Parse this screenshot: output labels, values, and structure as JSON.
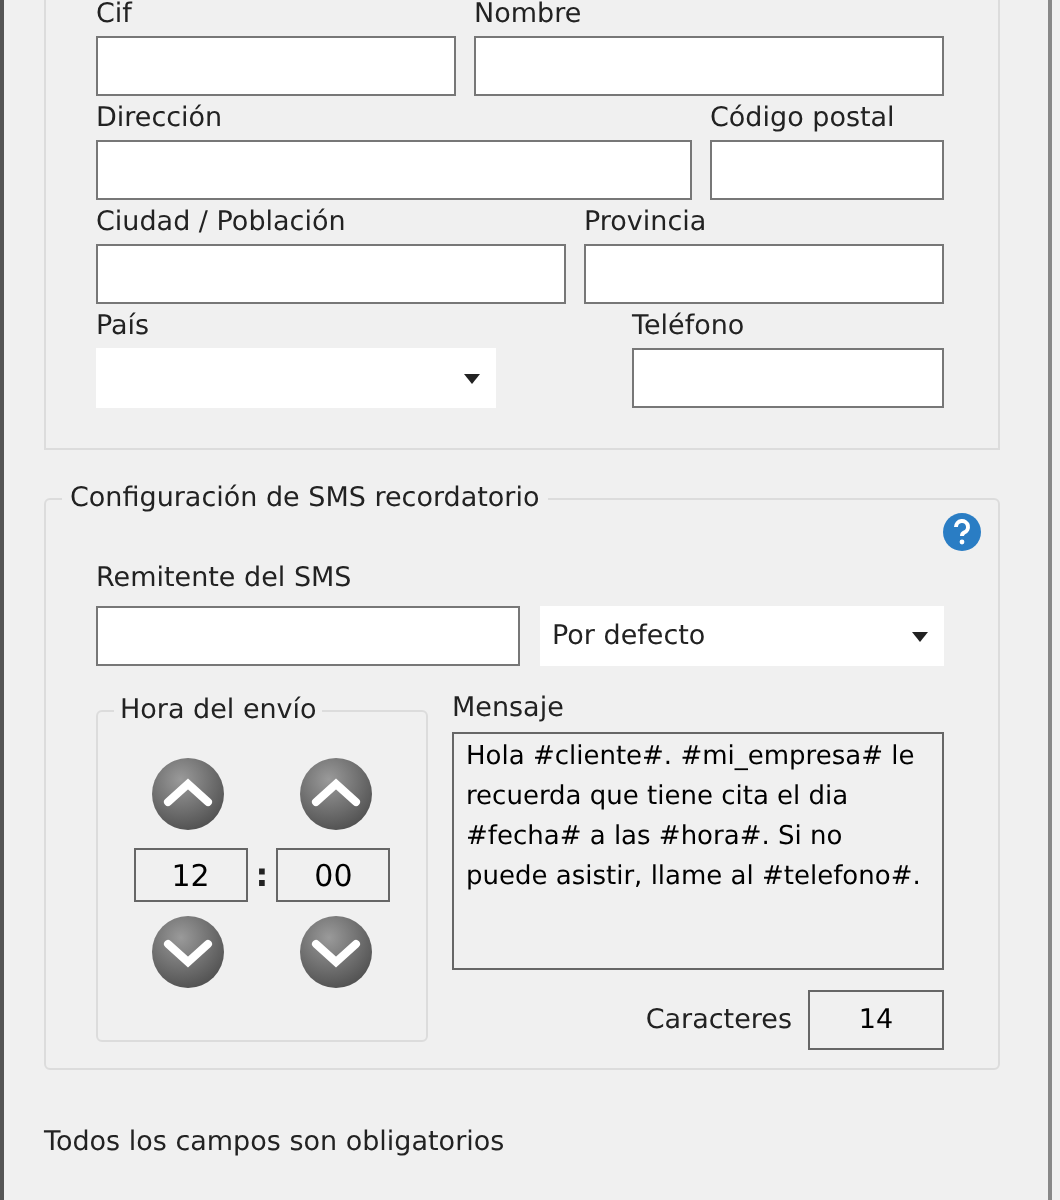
{
  "client_section": {
    "rows": [
      {
        "fields": [
          {
            "label": "Cif",
            "kind": "input"
          },
          {
            "label": "Nombre",
            "kind": "input"
          }
        ]
      },
      {
        "fields": [
          {
            "label": "Dirección",
            "kind": "input"
          },
          {
            "label": "Código postal",
            "kind": "input"
          }
        ]
      },
      {
        "fields": [
          {
            "label": "Ciudad / Población",
            "kind": "input"
          },
          {
            "label": "Provincia",
            "kind": "input"
          }
        ]
      },
      {
        "fields": [
          {
            "label": "País",
            "kind": "select"
          },
          {
            "label": "Teléfono",
            "kind": "input"
          }
        ]
      }
    ]
  },
  "sms_section": {
    "title": "Configuración de SMS recordatorio",
    "sender_label": "Remitente del SMS",
    "sender_option": "Por defecto",
    "time": {
      "title": "Hora del envío",
      "hour": "12",
      "separator": ":",
      "minute": "00"
    },
    "message_label": "Mensaje",
    "message": "Hola #cliente#. #mi_empresa# le recuerda que tiene cita el dia #fecha# a las #hora#. Si no puede asistir, llame al #telefono#.",
    "chars_label": "Caracteres",
    "chars": "14"
  },
  "footer": "Todos los campos son obligatorios"
}
